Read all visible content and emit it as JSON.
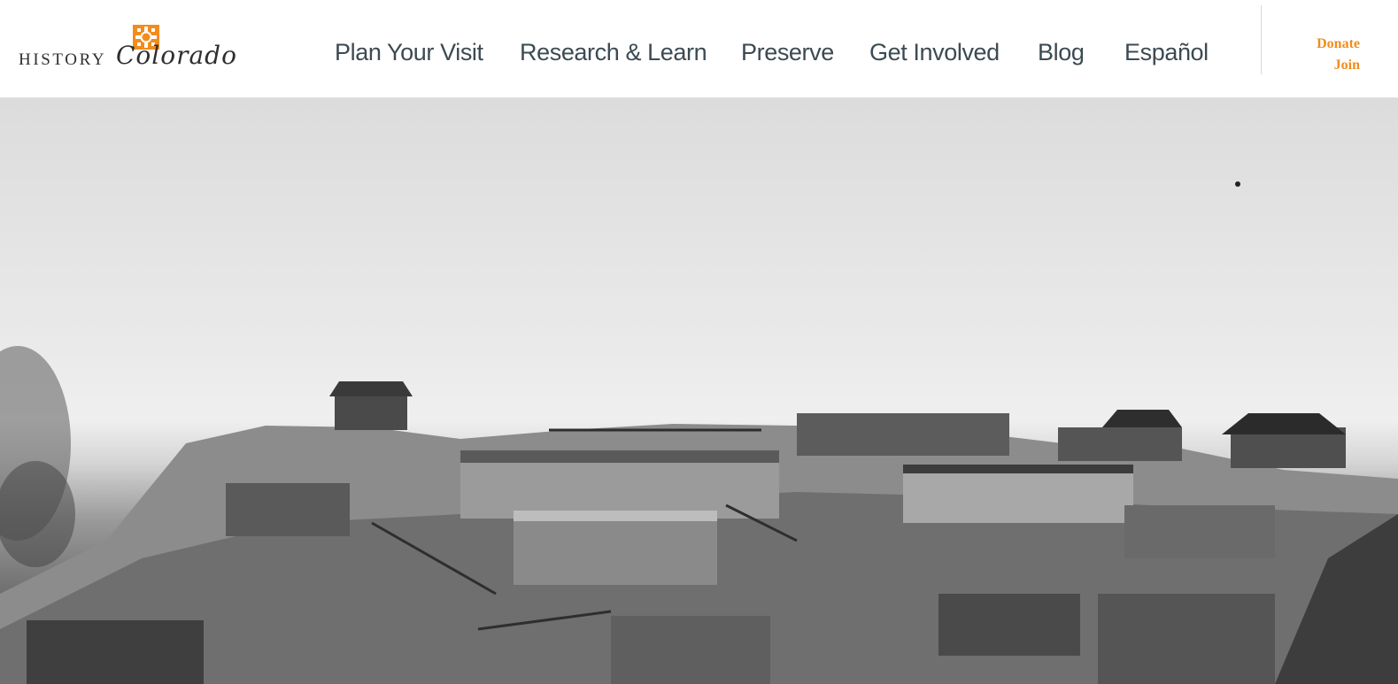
{
  "brand": {
    "wordmark_primary": "HISTORY",
    "wordmark_script": "Colorado",
    "logo_icon": "sun-emblem-icon",
    "accent_color": "#f28c1c",
    "nav_text_color": "#3c4a52"
  },
  "nav": {
    "items": [
      {
        "label": "Plan Your Visit"
      },
      {
        "label": "Research & Learn"
      },
      {
        "label": "Preserve"
      },
      {
        "label": "Get Involved"
      },
      {
        "label": "Blog"
      },
      {
        "label": "Español"
      }
    ]
  },
  "utility": {
    "donate_label": "Donate",
    "join_label": "Join"
  }
}
